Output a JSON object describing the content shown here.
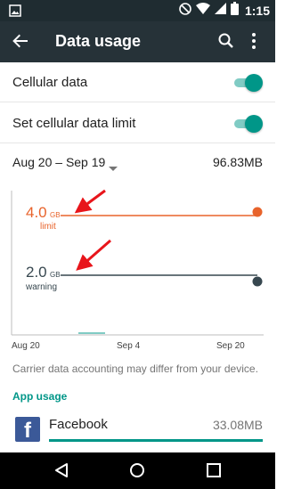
{
  "status_bar": {
    "time": "1:15",
    "icons": [
      "image-icon",
      "dnd-icon",
      "wifi-icon",
      "cellular-icon",
      "battery-icon"
    ]
  },
  "app_bar": {
    "title": "Data usage",
    "icons": [
      "back-arrow-icon",
      "search-icon",
      "more-vert-icon"
    ]
  },
  "settings": {
    "cellular_data": {
      "label": "Cellular data",
      "enabled": true
    },
    "data_limit": {
      "label": "Set cellular data limit",
      "enabled": true
    }
  },
  "cycle": {
    "range": "Aug 20 – Sep 19",
    "total": "96.83MB"
  },
  "chart_data": {
    "type": "line",
    "x_ticks": [
      "Aug 20",
      "Sep 4",
      "Sep 20"
    ],
    "limit": {
      "value": "4.0",
      "unit": "GB",
      "label": "limit",
      "color": "#e8632b"
    },
    "warning": {
      "value": "2.0",
      "unit": "GB",
      "label": "warning",
      "color": "#37474f"
    },
    "usage_color": "#80cbc4"
  },
  "disclaimer": "Carrier data accounting may differ from your device.",
  "app_usage": {
    "header": "App usage",
    "apps": [
      {
        "name": "Facebook",
        "amount": "33.08MB",
        "fraction": 1.0
      }
    ]
  },
  "colors": {
    "accent": "#009688",
    "annotation_arrow": "#e8151b"
  },
  "nav_bar": {
    "icons": [
      "back-triangle-icon",
      "home-circle-icon",
      "recents-square-icon"
    ]
  }
}
